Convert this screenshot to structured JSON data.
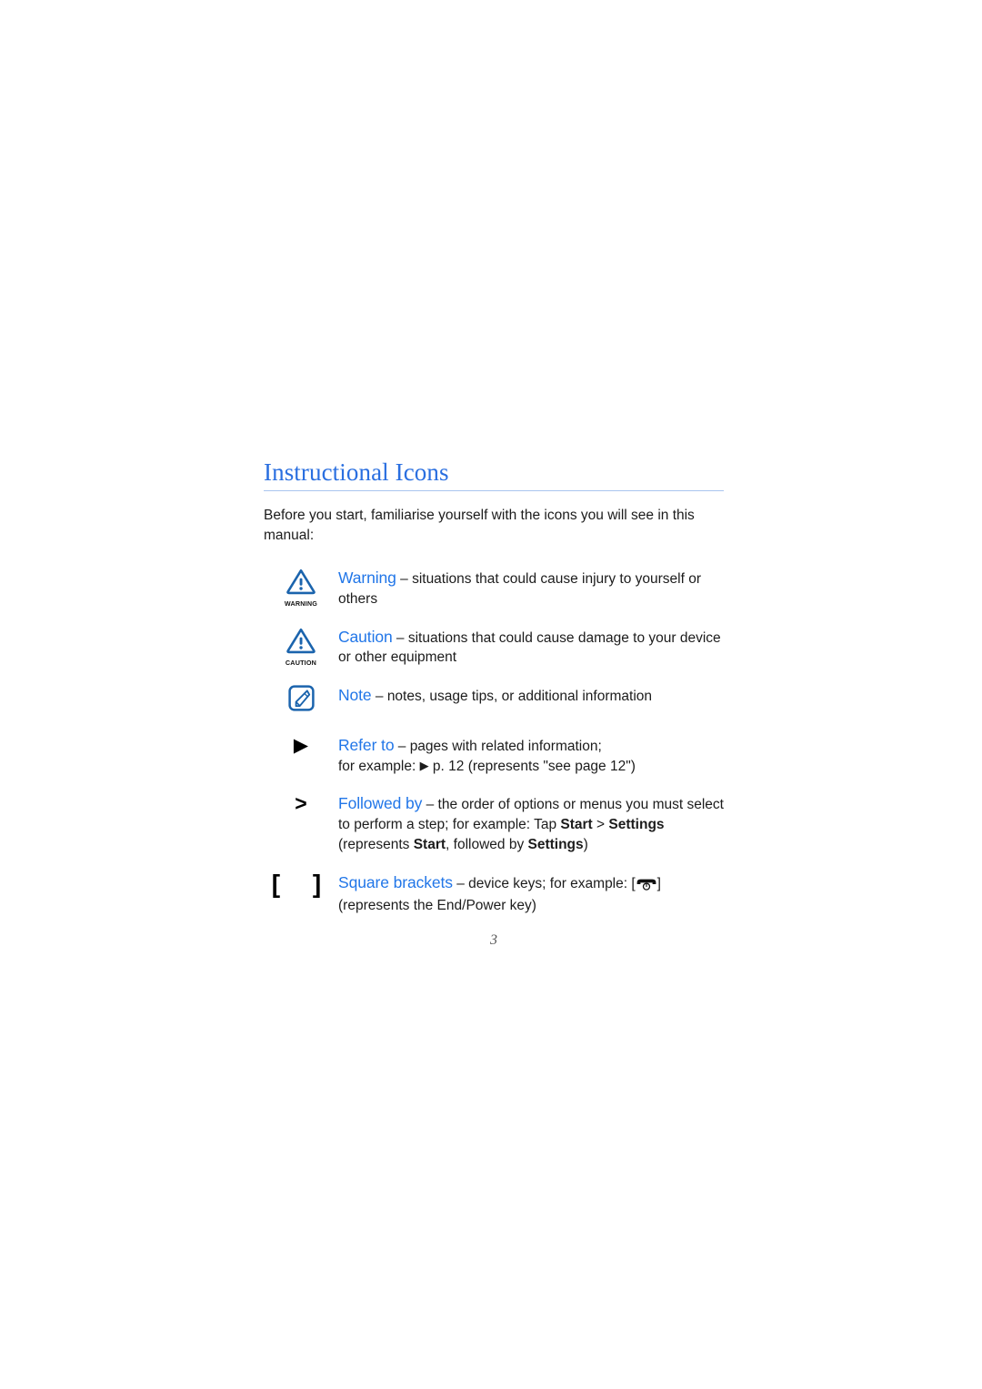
{
  "document": {
    "section_title": "Instructional Icons",
    "intro": "Before you start, familiarise yourself with the icons you will see in this manual:",
    "page_number": "3",
    "accent_color": "#2176e8",
    "title_color": "#2a6fe0",
    "rule_color": "#a9c5ee",
    "body_color": "#1c1c1c"
  },
  "rows": [
    {
      "icon": "warning-triangle-icon",
      "icon_label": "WARNING",
      "keyword": "Warning",
      "dash": " – ",
      "description": "situations that could cause injury to yourself or others"
    },
    {
      "icon": "caution-triangle-icon",
      "icon_label": "CAUTION",
      "keyword": "Caution",
      "dash": " – ",
      "description": "situations that could cause damage to your device or other equipment"
    },
    {
      "icon": "note-pen-icon",
      "icon_label": "",
      "keyword": "Note",
      "dash": " – ",
      "description": "notes, usage tips, or additional information"
    },
    {
      "icon": "right-triangle-icon",
      "icon_glyph": "▶",
      "keyword": "Refer to",
      "dash": " – ",
      "description": "pages with related information;",
      "line2_pre": "for example: ",
      "line2_glyph": "▶",
      "line2_post": " p. 12 (represents \"see page 12\")"
    },
    {
      "icon": "greater-than-icon",
      "icon_glyph": ">",
      "keyword": "Followed by",
      "dash": " – ",
      "description": "the order of options or menus you must select to perform a step; for example: Tap ",
      "bold1": "Start",
      "mid1": " > ",
      "bold2": "Settings",
      "mid2": " (represents ",
      "bold3": "Start",
      "mid3": ", followed by ",
      "bold4": "Settings",
      "tail": ")"
    },
    {
      "icon": "square-brackets-icon",
      "icon_glyph": "[ ]",
      "keyword": "Square brackets",
      "dash": " – ",
      "description": "device keys; for example: [",
      "key_icon": "end-power-key-icon",
      "post_key": "]",
      "line2": "(represents the End/Power key)"
    }
  ]
}
